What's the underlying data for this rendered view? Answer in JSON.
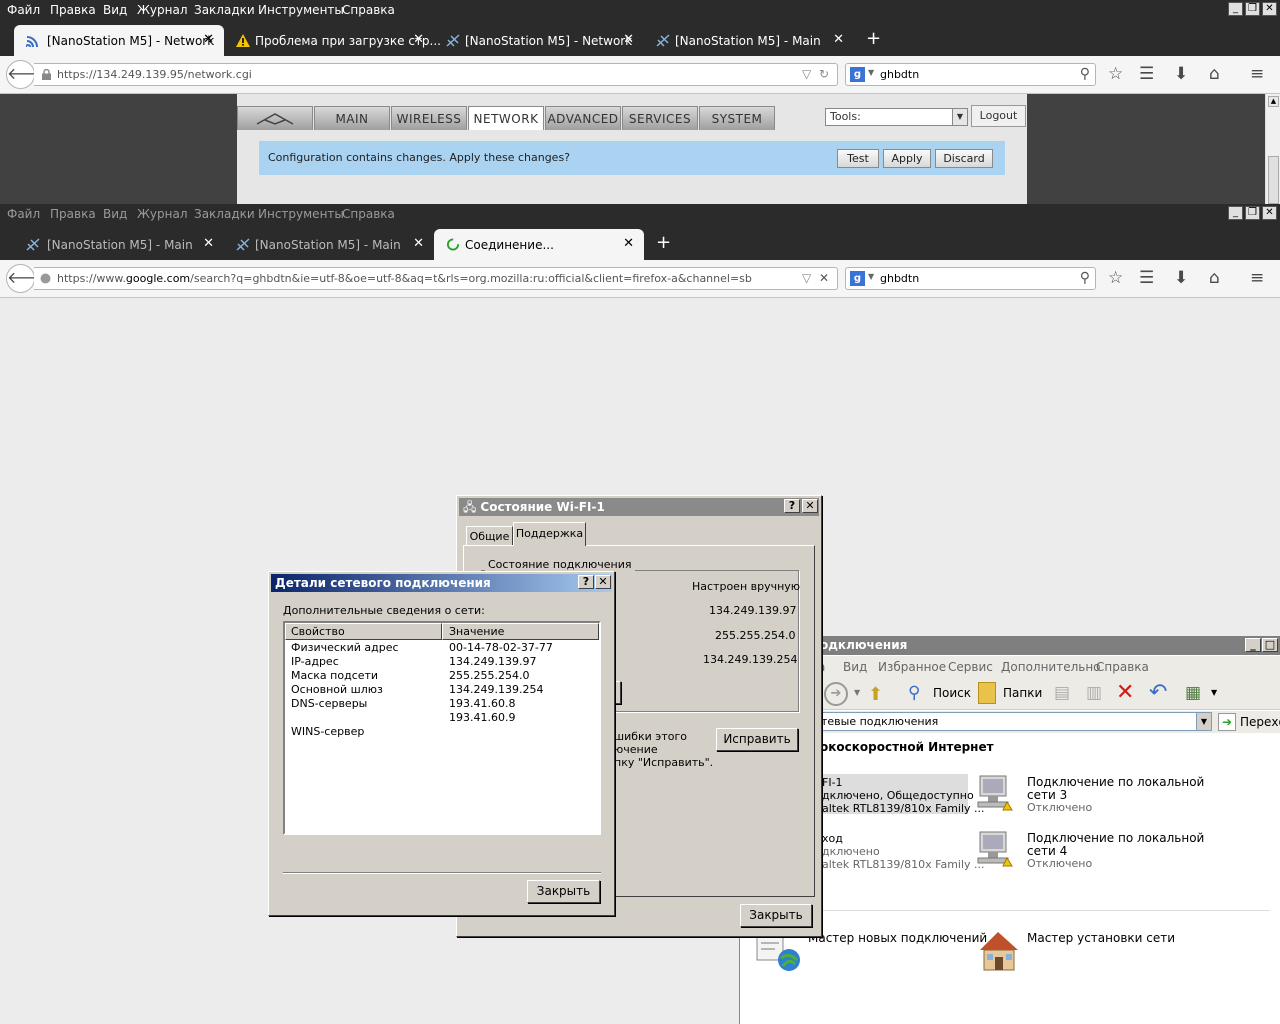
{
  "window1": {
    "menu": [
      "Файл",
      "Правка",
      "Вид",
      "Журнал",
      "Закладки",
      "Инструменты",
      "Справка"
    ],
    "tabs": [
      {
        "label": "[NanoStation M5] - Network",
        "active": true
      },
      {
        "label": "Проблема при загрузке стр...",
        "active": false
      },
      {
        "label": "[NanoStation M5] - Network",
        "active": false
      },
      {
        "label": "[NanoStation M5] - Main",
        "active": false
      }
    ],
    "new_tab": "+",
    "close": "✕",
    "url": "https://134.249.139.95/network.cgi",
    "search": "ghbdtn"
  },
  "nanostation": {
    "tabs": [
      "MAIN",
      "WIRELESS",
      "NETWORK",
      "ADVANCED",
      "SERVICES",
      "SYSTEM"
    ],
    "active_tab": "NETWORK",
    "tools_label": "Tools:",
    "logout": "Logout",
    "notice": "Configuration contains changes. Apply these changes?",
    "buttons": {
      "test": "Test",
      "apply": "Apply",
      "discard": "Discard"
    }
  },
  "window2": {
    "menu": [
      "Файл",
      "Правка",
      "Вид",
      "Журнал",
      "Закладки",
      "Инструменты",
      "Справка"
    ],
    "tabs": [
      {
        "label": "[NanoStation M5] - Main",
        "active": false
      },
      {
        "label": "[NanoStation M5] - Main",
        "active": false
      },
      {
        "label": "Соединение...",
        "active": true
      }
    ],
    "url_prefix": "https://www.",
    "url_host": "google.com",
    "url_rest": "/search?q=ghbdtn&ie=utf-8&oe=utf-8&aq=t&rls=org.mozilla:ru:official&client=firefox-a&channel=sb",
    "search": "ghbdtn"
  },
  "status_dialog": {
    "title": "Состояние Wi-FI-1",
    "tabs": [
      "Общие",
      "Поддержка"
    ],
    "group": "Состояние подключения",
    "values": [
      "Настроен вручную",
      "134.249.139.97",
      "255.255.254.0",
      "134.249.139.254"
    ],
    "repair_text": [
      "шибки этого",
      "ючение",
      "пку \"Исправить\"."
    ],
    "repair_button": "Исправить",
    "close_button": "Закрыть"
  },
  "details_dialog": {
    "title": "Детали сетевого подключения",
    "subtitle": "Дополнительные сведения о сети:",
    "columns": [
      "Свойство",
      "Значение"
    ],
    "rows": [
      {
        "prop": "Физический адрес",
        "value": "00-14-78-02-37-77"
      },
      {
        "prop": "IP-адрес",
        "value": "134.249.139.97"
      },
      {
        "prop": "Маска подсети",
        "value": "255.255.254.0"
      },
      {
        "prop": "Основной шлюз",
        "value": "134.249.139.254"
      },
      {
        "prop": "DNS-серверы",
        "value": "193.41.60.8"
      },
      {
        "prop": "",
        "value": "193.41.60.9"
      },
      {
        "prop": "WINS-сервер",
        "value": ""
      }
    ],
    "close_button": "Закрыть"
  },
  "explorer": {
    "title": "одключения",
    "menu": [
      "а",
      "Вид",
      "Избранное",
      "Сервис",
      "Дополнительно",
      "Справка"
    ],
    "toolbar": {
      "search": "Поиск",
      "folders": "Папки"
    },
    "address": "тевые подключения",
    "go": "Перехо",
    "section": "окоскоростной Интернет",
    "items": [
      {
        "name": "FI-1",
        "status": "дключено, Общедоступно",
        "device": "altek RTL8139/810x Family ..."
      },
      {
        "name": "ход",
        "status": "дключено",
        "device": "altek RTL8139/810x Family ..."
      }
    ],
    "lan": [
      {
        "name1": "Подключение по локальной",
        "name2": "сети 3",
        "status": "Отключено"
      },
      {
        "name1": "Подключение по локальной",
        "name2": "сети 4",
        "status": "Отключено"
      }
    ],
    "wizards": [
      "Мастер новых подключений",
      "Мастер установки сети"
    ]
  }
}
